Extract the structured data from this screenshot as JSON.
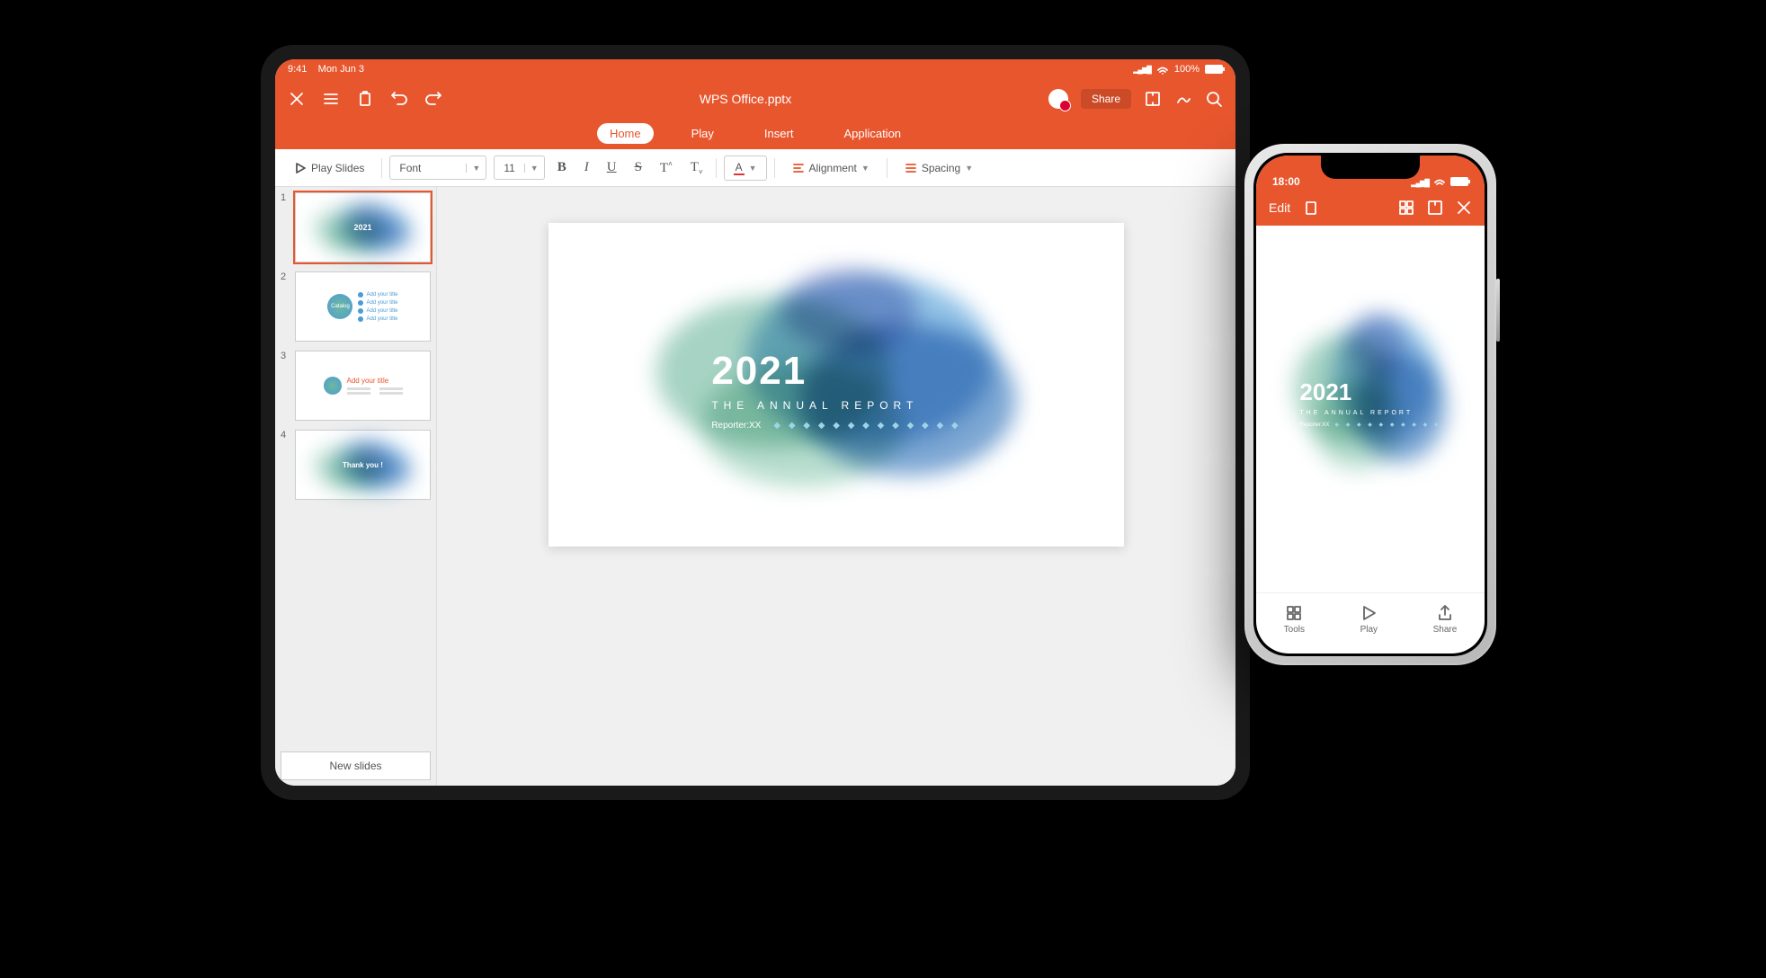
{
  "tablet": {
    "status": {
      "time": "9:41",
      "date": "Mon Jun 3",
      "battery": "100%"
    },
    "filename": "WPS Office.pptx",
    "share": "Share",
    "tabs": {
      "home": "Home",
      "play": "Play",
      "insert": "Insert",
      "application": "Application"
    },
    "toolbar": {
      "play_slides": "Play Slides",
      "font_label": "Font",
      "font_size": "11",
      "alignment": "Alignment",
      "spacing": "Spacing"
    },
    "slides": {
      "s1": {
        "num": "1",
        "year": "2021"
      },
      "s2": {
        "num": "2",
        "label": "Catalog",
        "item": "Add your title"
      },
      "s3": {
        "num": "3",
        "label": "Add your title"
      },
      "s4": {
        "num": "4",
        "label": "Thank you !"
      },
      "new": "New slides"
    },
    "main_slide": {
      "year": "2021",
      "subtitle": "THE ANNUAL REPORT",
      "reporter": "Reporter:XX",
      "dots": "◆ ◆ ◆ ◆ ◆ ◆ ◆ ◆ ◆ ◆ ◆ ◆ ◆"
    }
  },
  "phone": {
    "status": {
      "time": "18:00"
    },
    "edit": "Edit",
    "slide": {
      "year": "2021",
      "subtitle": "THE ANNUAL REPORT",
      "reporter": "Reporter:XX",
      "dots": "◆ ◆ ◆ ◆ ◆ ◆ ◆ ◆ ◆ ◆"
    },
    "nav": {
      "tools": "Tools",
      "play": "Play",
      "share": "Share"
    }
  }
}
